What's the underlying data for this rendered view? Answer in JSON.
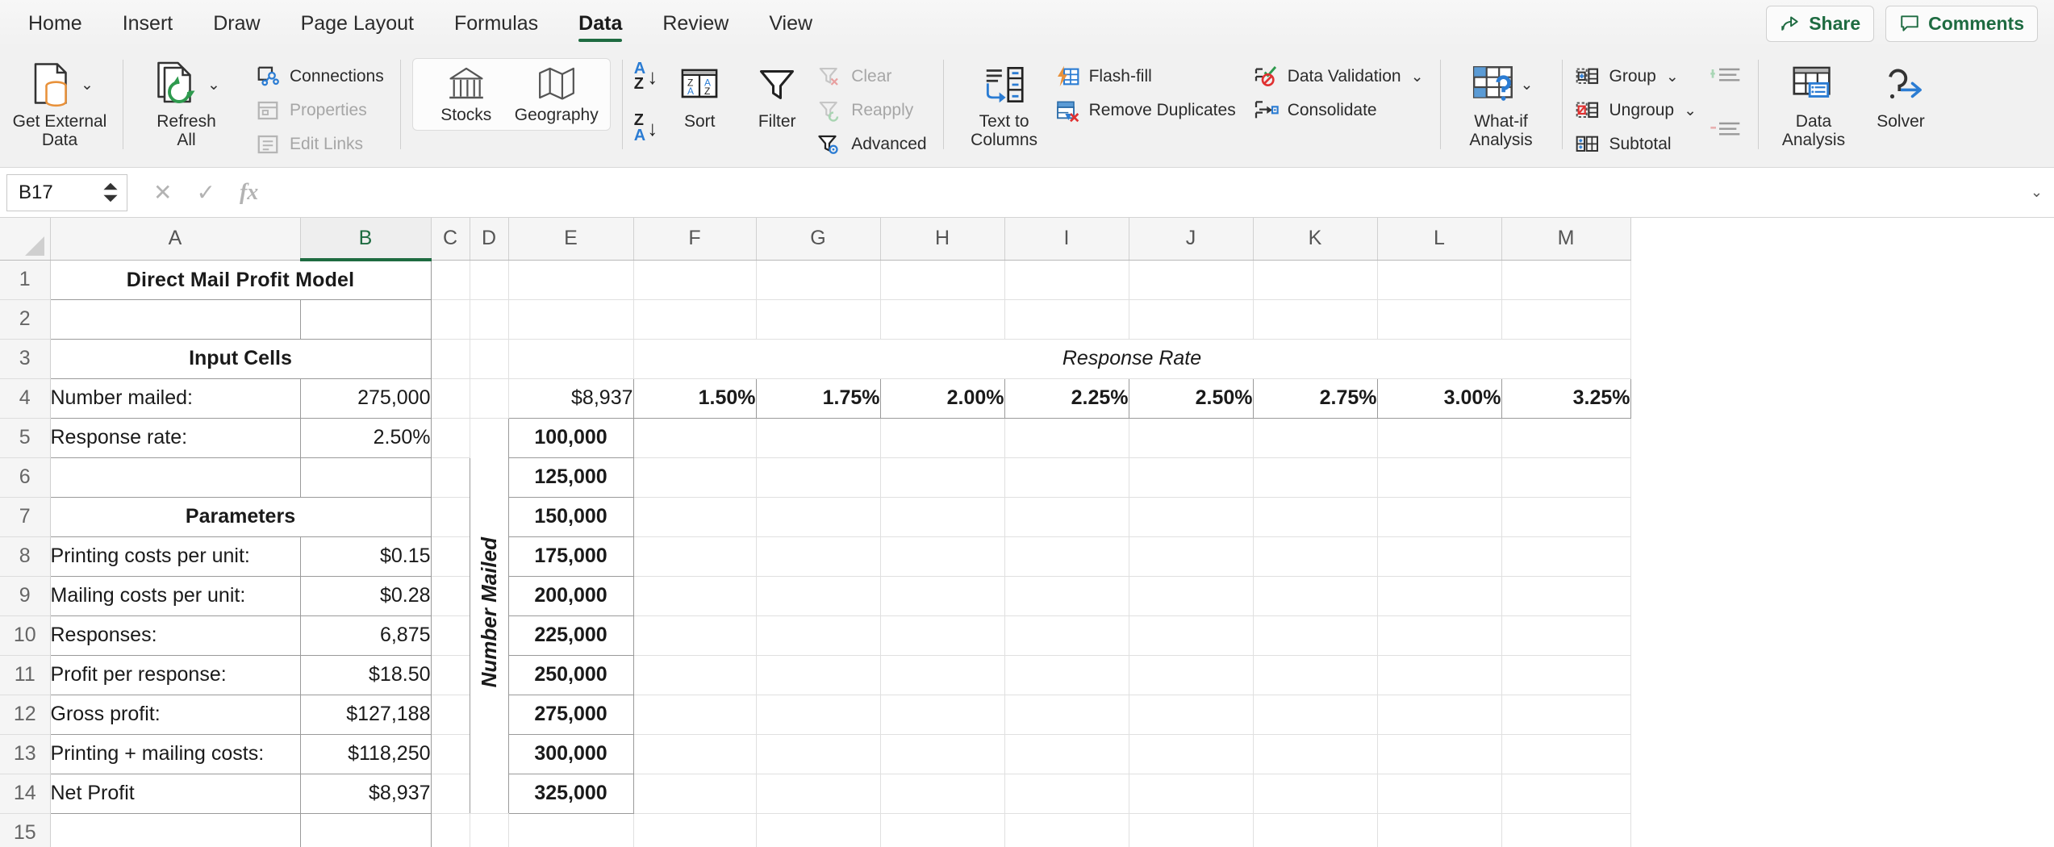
{
  "ribbon_tabs": [
    {
      "label": "Home",
      "active": false
    },
    {
      "label": "Insert",
      "active": false
    },
    {
      "label": "Draw",
      "active": false
    },
    {
      "label": "Page Layout",
      "active": false
    },
    {
      "label": "Formulas",
      "active": false
    },
    {
      "label": "Data",
      "active": true
    },
    {
      "label": "Review",
      "active": false
    },
    {
      "label": "View",
      "active": false
    }
  ],
  "titlebar": {
    "share_label": "Share",
    "share_icon": "share-arrow-icon",
    "comments_label": "Comments",
    "comments_icon": "comment-bubble-icon",
    "accent_color": "#1e6b41"
  },
  "ribbon": {
    "get_external_data": {
      "label": "Get External\nData",
      "label_line1": "Get External",
      "label_line2": "Data",
      "icon": "database-document-icon",
      "has_dropdown": true
    },
    "refresh_all": {
      "label_line1": "Refresh",
      "label_line2": "All",
      "icon": "refresh-all-icon",
      "has_dropdown": true
    },
    "connections_group": [
      {
        "label": "Connections",
        "icon": "connections-icon",
        "disabled": false
      },
      {
        "label": "Properties",
        "icon": "properties-icon",
        "disabled": true
      },
      {
        "label": "Edit Links",
        "icon": "edit-links-icon",
        "disabled": true
      }
    ],
    "data_types": [
      {
        "label": "Stocks",
        "icon": "stocks-bank-icon"
      },
      {
        "label": "Geography",
        "icon": "geography-map-icon"
      }
    ],
    "sort_buttons": [
      {
        "label": "A to Z sort",
        "icon": "sort-ascending-icon",
        "top": "A",
        "bottom": "Z"
      },
      {
        "label": "Z to A sort",
        "icon": "sort-descending-icon",
        "top": "Z",
        "bottom": "A"
      }
    ],
    "sort": {
      "label": "Sort",
      "icon": "sort-dialog-icon"
    },
    "filter": {
      "label": "Filter",
      "icon": "funnel-icon"
    },
    "filter_small": [
      {
        "label": "Clear",
        "icon": "funnel-clear-icon",
        "disabled": true
      },
      {
        "label": "Reapply",
        "icon": "funnel-reapply-icon",
        "disabled": true
      },
      {
        "label": "Advanced",
        "icon": "funnel-advanced-icon",
        "disabled": false
      }
    ],
    "text_to_columns": {
      "label_line1": "Text to",
      "label_line2": "Columns",
      "icon": "text-to-columns-icon"
    },
    "data_tools": [
      {
        "label": "Flash-fill",
        "icon": "flash-fill-icon"
      },
      {
        "label": "Remove Duplicates",
        "icon": "remove-duplicates-icon"
      }
    ],
    "validation_tools": [
      {
        "label": "Data Validation",
        "icon": "data-validation-icon",
        "has_dropdown": true
      },
      {
        "label": "Consolidate",
        "icon": "consolidate-icon",
        "has_dropdown": false
      }
    ],
    "what_if": {
      "label_line1": "What-if",
      "label_line2": "Analysis",
      "icon": "what-if-analysis-icon",
      "has_dropdown": true
    },
    "outline": [
      {
        "label": "Group",
        "icon": "group-icon",
        "has_dropdown": true
      },
      {
        "label": "Ungroup",
        "icon": "ungroup-icon",
        "has_dropdown": true
      },
      {
        "label": "Subtotal",
        "icon": "subtotal-icon",
        "has_dropdown": false
      }
    ],
    "outline_detail": [
      {
        "label": "Show Detail",
        "icon": "show-detail-icon"
      },
      {
        "label": "Hide Detail",
        "icon": "hide-detail-icon"
      }
    ],
    "analysis": [
      {
        "label_line1": "Data",
        "label_line2": "Analysis",
        "icon": "data-analysis-icon"
      },
      {
        "label_line1": "Solver",
        "label_line2": "",
        "icon": "solver-icon"
      }
    ]
  },
  "formula_bar": {
    "name_box_value": "B17",
    "cancel_icon": "cancel-x-icon",
    "confirm_icon": "confirm-check-icon",
    "function_icon": "fx-icon",
    "formula_value": ""
  },
  "grid": {
    "column_headers": [
      "A",
      "B",
      "C",
      "D",
      "E",
      "F",
      "G",
      "H",
      "I",
      "J",
      "K",
      "L",
      "M"
    ],
    "selected_column": "B",
    "row_headers": [
      "1",
      "2",
      "3",
      "4",
      "5",
      "6",
      "7",
      "8",
      "9",
      "10",
      "11",
      "12",
      "13",
      "14",
      "15"
    ]
  },
  "sheet": {
    "title": "Direct Mail Profit Model",
    "input_cells_header": "Input Cells",
    "parameters_header": "Parameters",
    "input_rows": [
      {
        "label": "Number mailed:",
        "value": "275,000"
      },
      {
        "label": "Response rate:",
        "value": "2.50%"
      }
    ],
    "parameter_rows": [
      {
        "label": "Printing costs per unit:",
        "value": "$0.15"
      },
      {
        "label": "Mailing costs per unit:",
        "value": "$0.28"
      },
      {
        "label": "Responses:",
        "value": "6,875"
      },
      {
        "label": "Profit per response:",
        "value": "$18.50"
      },
      {
        "label": "Gross profit:",
        "value": "$127,188"
      },
      {
        "label": "Printing + mailing costs:",
        "value": "$118,250"
      },
      {
        "label": "Net Profit",
        "value": "$8,937"
      }
    ],
    "data_table": {
      "corner_formula_value": "$8,937",
      "column_axis_title": "Response Rate",
      "row_axis_title": "Number Mailed",
      "response_rates": [
        "1.50%",
        "1.75%",
        "2.00%",
        "2.25%",
        "2.50%",
        "2.75%",
        "3.00%",
        "3.25%"
      ],
      "numbers_mailed": [
        "100,000",
        "125,000",
        "150,000",
        "175,000",
        "200,000",
        "225,000",
        "250,000",
        "275,000",
        "300,000",
        "325,000"
      ],
      "body_values": [
        [
          "",
          "",
          "",
          "",
          "",
          "",
          "",
          ""
        ],
        [
          "",
          "",
          "",
          "",
          "",
          "",
          "",
          ""
        ],
        [
          "",
          "",
          "",
          "",
          "",
          "",
          "",
          ""
        ],
        [
          "",
          "",
          "",
          "",
          "",
          "",
          "",
          ""
        ],
        [
          "",
          "",
          "",
          "",
          "",
          "",
          "",
          ""
        ],
        [
          "",
          "",
          "",
          "",
          "",
          "",
          "",
          ""
        ],
        [
          "",
          "",
          "",
          "",
          "",
          "",
          "",
          ""
        ],
        [
          "",
          "",
          "",
          "",
          "",
          "",
          "",
          ""
        ],
        [
          "",
          "",
          "",
          "",
          "",
          "",
          "",
          ""
        ],
        [
          "",
          "",
          "",
          "",
          "",
          "",
          "",
          ""
        ]
      ]
    }
  }
}
